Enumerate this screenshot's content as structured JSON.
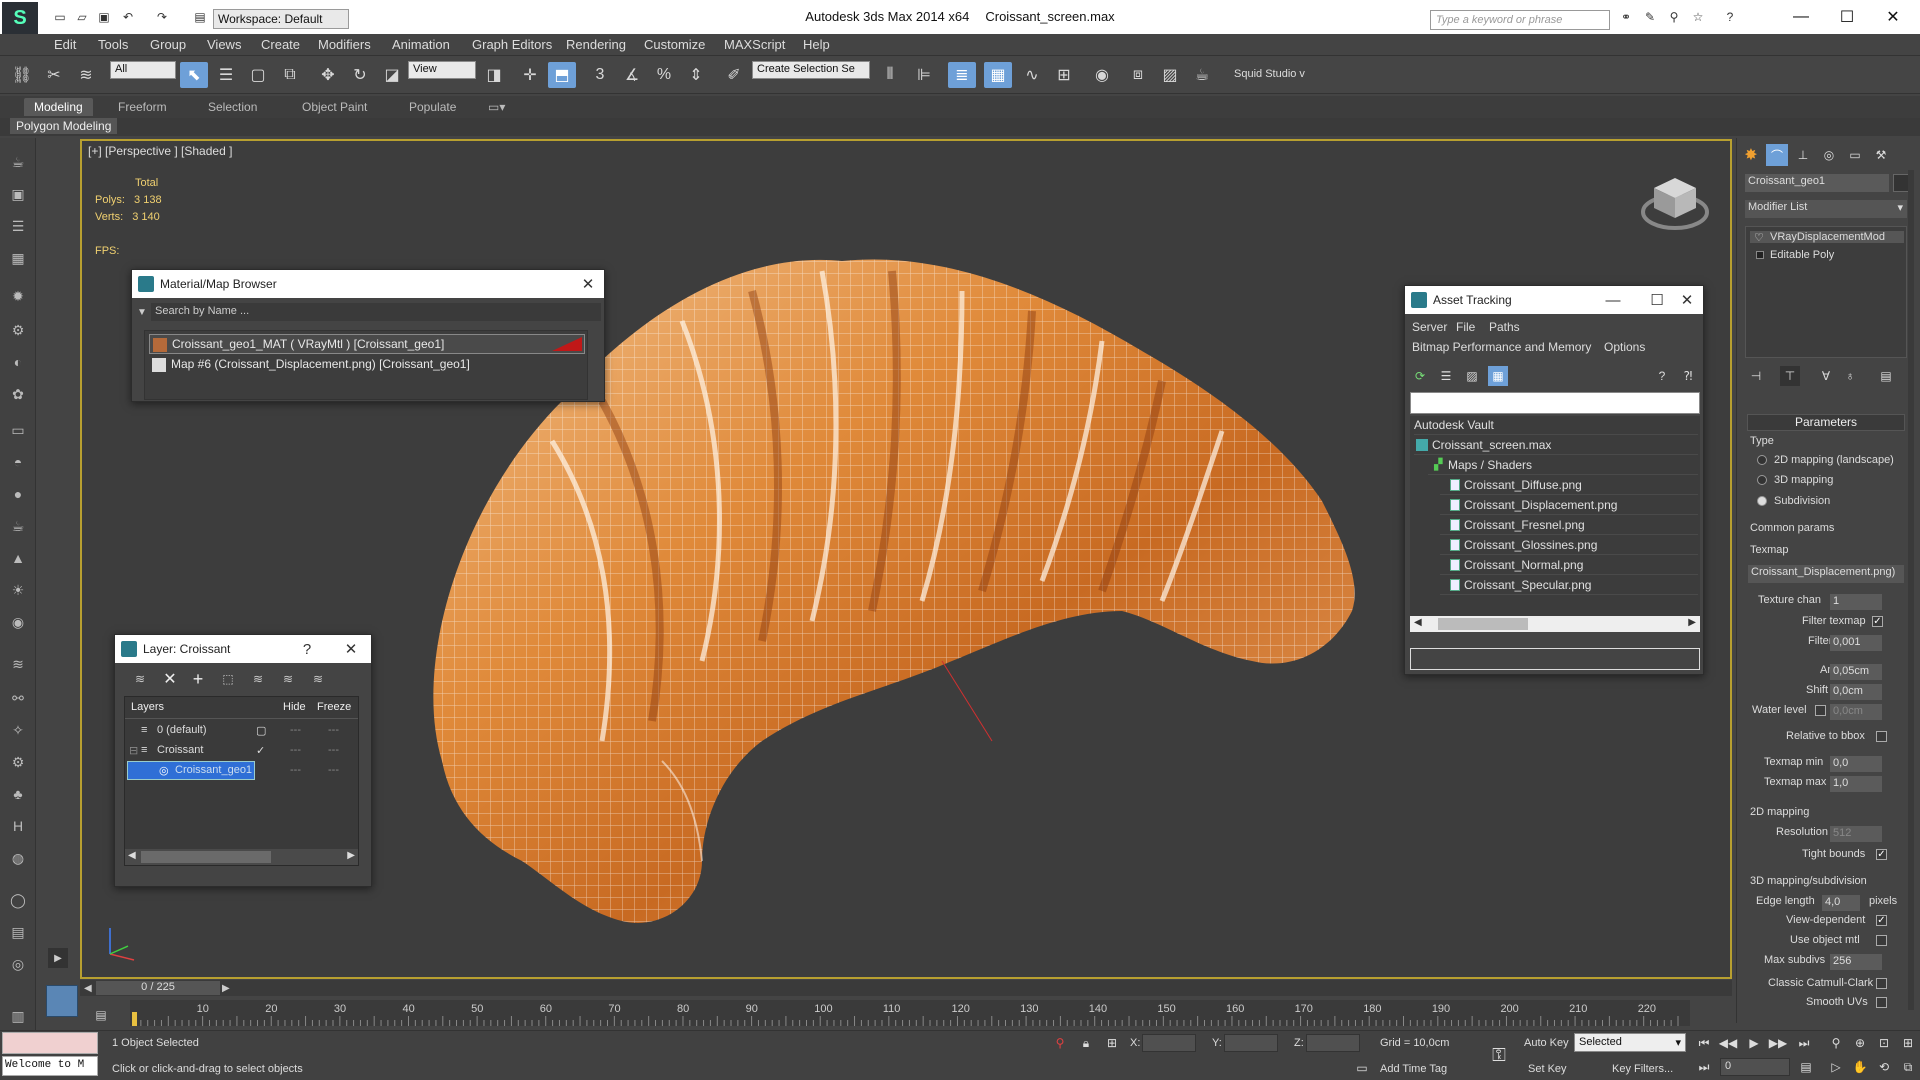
{
  "app": {
    "title": "Autodesk 3ds Max  2014 x64",
    "file": "Croissant_screen.max",
    "workspace": "Workspace: Default",
    "search_placeholder": "Type a keyword or phrase"
  },
  "menus": [
    "Edit",
    "Tools",
    "Group",
    "Views",
    "Create",
    "Modifiers",
    "Animation",
    "Graph Editors",
    "Rendering",
    "Customize",
    "MAXScript",
    "Help"
  ],
  "toolbar": {
    "selection_filter": "All",
    "ref_coord": "View",
    "named_sel": "Create Selection Se",
    "squid": "Squid Studio v"
  },
  "ribbon": {
    "tabs": [
      "Modeling",
      "Freeform",
      "Selection",
      "Object Paint",
      "Populate"
    ],
    "sub": "Polygon Modeling"
  },
  "viewport": {
    "label": "[+] [Perspective ] [Shaded ]",
    "total": "Total",
    "polys_label": "Polys:",
    "polys": "3 138",
    "verts_label": "Verts:",
    "verts": "3 140",
    "fps_label": "FPS:"
  },
  "material_browser": {
    "title": "Material/Map Browser",
    "search": "Search by Name ...",
    "items": [
      "Croissant_geo1_MAT ( VRayMtl ) [Croissant_geo1]",
      "Map #6 (Croissant_Displacement.png) [Croissant_geo1]"
    ]
  },
  "layer_window": {
    "title": "Layer: Croissant",
    "help": "?",
    "cols": [
      "Layers",
      "Hide",
      "Freeze"
    ],
    "rows": [
      "0 (default)",
      "Croissant",
      "Croissant_geo1"
    ]
  },
  "asset_tracking": {
    "title": "Asset Tracking",
    "menu1": [
      "Server",
      "File",
      "Paths"
    ],
    "menu2": [
      "Bitmap Performance and Memory",
      "Options"
    ],
    "rows": [
      "Autodesk Vault",
      "Croissant_screen.max",
      "Maps / Shaders",
      "Croissant_Diffuse.png",
      "Croissant_Displacement.png",
      "Croissant_Fresnel.png",
      "Croissant_Glossines.png",
      "Croissant_Normal.png",
      "Croissant_Specular.png"
    ]
  },
  "command_panel": {
    "object_name": "Croissant_geo1",
    "modifier_list": "Modifier List",
    "stack": [
      "VRayDisplacementMod",
      "Editable Poly"
    ],
    "parameters": "Parameters",
    "type": "Type",
    "type_options": [
      "2D mapping (landscape)",
      "3D mapping",
      "Subdivision"
    ],
    "common": "Common params",
    "texmap": "Texmap",
    "texmap_value": "Croissant_Displacement.png)",
    "texture_chan": "Texture chan",
    "texture_chan_val": "1",
    "filter_texmap": "Filter texmap",
    "filter_blur": "Filter blur",
    "filter_blur_val": "0,001",
    "amount": "Amount",
    "amount_val": "0,05cm",
    "shift": "Shift",
    "shift_val": "0,0cm",
    "water": "Water level",
    "water_val": "0,0cm",
    "relative": "Relative to bbox",
    "texmap_min": "Texmap min",
    "texmap_min_val": "0,0",
    "texmap_max": "Texmap max",
    "texmap_max_val": "1,0",
    "map2d": "2D mapping",
    "resolution": "Resolution",
    "resolution_val": "512",
    "tight": "Tight bounds",
    "map3d": "3D mapping/subdivision",
    "edge": "Edge length",
    "edge_val": "4,0",
    "pixels": "pixels",
    "view_dep": "View-dependent",
    "use_obj": "Use object mtl",
    "max_sub": "Max subdivs",
    "max_sub_val": "256",
    "catmull": "Classic Catmull-Clark",
    "smooth": "Smooth UVs"
  },
  "timeline": {
    "frame": "0 / 225",
    "ticks": [
      "10",
      "20",
      "30",
      "40",
      "50",
      "60",
      "70",
      "80",
      "90",
      "100",
      "110",
      "120",
      "130",
      "140",
      "150",
      "160",
      "170",
      "180",
      "190",
      "200",
      "210",
      "220"
    ]
  },
  "status": {
    "welcome": "Welcome to M",
    "selected": "1 Object Selected",
    "prompt": "Click or click-and-drag to select objects",
    "x": "X:",
    "y": "Y:",
    "z": "Z:",
    "grid": "Grid = 10,0cm",
    "add_tag": "Add Time Tag",
    "auto_key": "Auto Key",
    "set_key": "Set Key",
    "selected_dd": "Selected",
    "key_filters": "Key Filters...",
    "frame_val": "0"
  },
  "colors": {
    "accent": "#6ea0d8",
    "viewport_border": "#b8a030",
    "selection": "#2f6fd6"
  }
}
